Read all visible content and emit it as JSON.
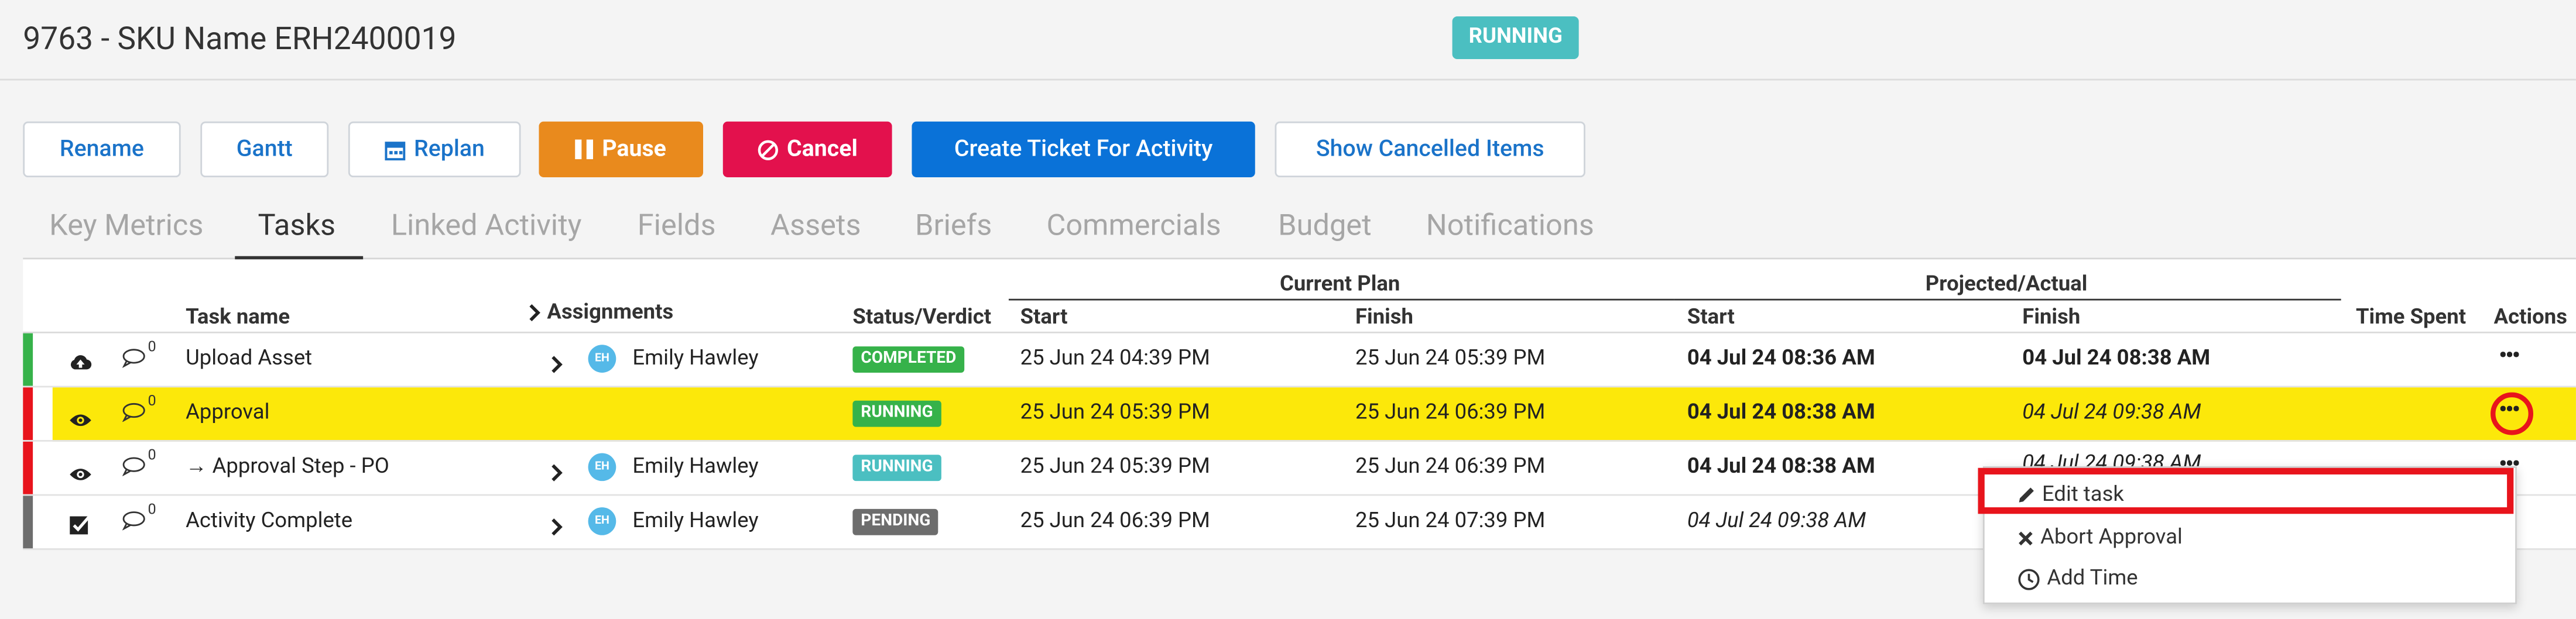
{
  "header": {
    "title": "9763 - SKU Name ERH2400019",
    "status": "RUNNING"
  },
  "toolbar": {
    "rename": "Rename",
    "gantt": "Gantt",
    "replan": "Replan",
    "pause": "Pause",
    "cancel": "Cancel",
    "create_ticket": "Create Ticket For Activity",
    "show_cancelled": "Show Cancelled Items"
  },
  "tabs": [
    "Key Metrics",
    "Tasks",
    "Linked Activity",
    "Fields",
    "Assets",
    "Briefs",
    "Commercials",
    "Budget",
    "Notifications"
  ],
  "active_tab": "Tasks",
  "table": {
    "group_headers": {
      "current_plan": "Current Plan",
      "projected_actual": "Projected/Actual"
    },
    "columns": {
      "task_name": "Task name",
      "assignments": "Assignments",
      "status": "Status/Verdict",
      "cp_start": "Start",
      "cp_finish": "Finish",
      "pa_start": "Start",
      "pa_finish": "Finish",
      "time_spent": "Time Spent",
      "actions": "Actions"
    },
    "rows": [
      {
        "icon": "cloud-upload-icon",
        "comments": "0",
        "name": "Upload Asset",
        "assignee": "Emily Hawley",
        "initials": "EH",
        "status": "COMPLETED",
        "cp_start": "25 Jun 24 04:39 PM",
        "cp_finish": "25 Jun 24 05:39 PM",
        "pa_start": "04 Jul 24 08:36 AM",
        "pa_finish": "04 Jul 24 08:38 AM",
        "actions": "•••"
      },
      {
        "icon": "eye-icon",
        "comments": "0",
        "name": "Approval",
        "assignee": "",
        "initials": "",
        "status": "RUNNING",
        "cp_start": "25 Jun 24 05:39 PM",
        "cp_finish": "25 Jun 24 06:39 PM",
        "pa_start": "04 Jul 24 08:38 AM",
        "pa_finish": "04 Jul 24 09:38 AM",
        "actions": "•••"
      },
      {
        "icon": "eye-icon",
        "comments": "0",
        "name": "→ Approval Step - PO",
        "assignee": "Emily Hawley",
        "initials": "EH",
        "status": "RUNNING",
        "cp_start": "25 Jun 24 05:39 PM",
        "cp_finish": "25 Jun 24 06:39 PM",
        "pa_start": "04 Jul 24 08:38 AM",
        "pa_finish": "04 Jul 24 09:38 AM",
        "actions": "•••"
      },
      {
        "icon": "checkbox-icon",
        "comments": "0",
        "name": "Activity Complete",
        "assignee": "Emily Hawley",
        "initials": "EH",
        "status": "PENDING",
        "cp_start": "25 Jun 24 06:39 PM",
        "cp_finish": "25 Jun 24 07:39 PM",
        "pa_start": "04 Jul 24 09:38 AM",
        "pa_finish": "",
        "actions": ""
      }
    ]
  },
  "context_menu": {
    "edit": "Edit task",
    "abort": "Abort Approval",
    "add_time": "Add Time"
  },
  "colors": {
    "running": "#4bbfc1",
    "completed": "#36b24a",
    "pending": "#6d6d6d",
    "highlight": "#fce80a",
    "pause": "#e98a1d",
    "cancel": "#e3114d",
    "primary": "#0a72d8",
    "annotation": "#e8141c"
  }
}
